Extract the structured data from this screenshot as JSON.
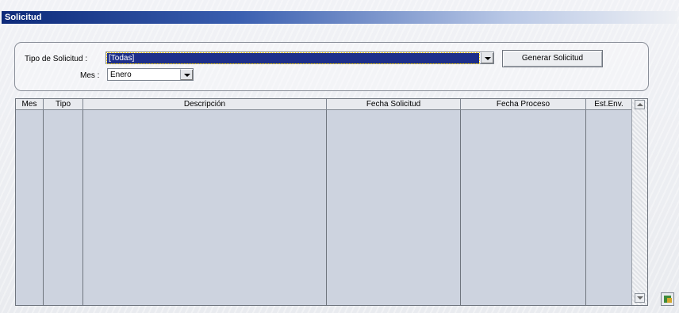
{
  "window": {
    "title": "Solicitud"
  },
  "filters": {
    "tipo_label": "Tipo de Solicitud :",
    "tipo_value": "[Todas]",
    "mes_label": "Mes :",
    "mes_value": "Enero",
    "generate_label": "Generar Solicitud"
  },
  "grid": {
    "columns": [
      "Mes",
      "Tipo",
      "Descripción",
      "Fecha Solicitud",
      "Fecha Proceso",
      "Est.Env."
    ],
    "rows": []
  },
  "icons": {
    "dropdown": "chevron-down-icon",
    "scroll_up": "arrow-up-icon",
    "scroll_down": "arrow-down-icon",
    "corner": "export-icon"
  }
}
